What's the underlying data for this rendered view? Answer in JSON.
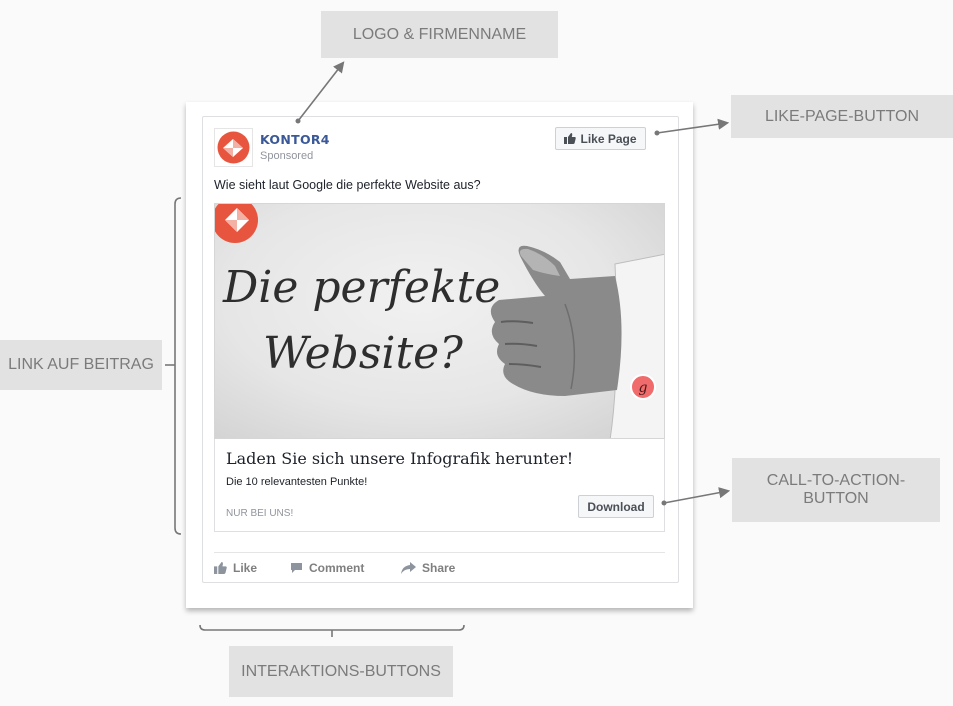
{
  "callouts": {
    "logo": "LOGO & FIRMENNAME",
    "like_page": "LIKE-PAGE-BUTTON",
    "link": "LINK AUF BEITRAG",
    "cta": "CALL-TO-ACTION-\nBUTTON",
    "interactions": "INTERAKTIONS-BUTTONS"
  },
  "ad": {
    "page_name": "KONTOR4",
    "sponsored": "Sponsored",
    "like_page_label": "Like Page",
    "post_text": "Wie sieht laut Google die perfekte Website aus?",
    "image_text_line1": "Die perfekte",
    "image_text_line2": "Website?",
    "badge_letter": "g",
    "link_title": "Laden Sie sich unsere Infografik herunter!",
    "link_description": "Die 10 relevantesten Punkte!",
    "link_domain": "NUR BEI UNS!",
    "cta_label": "Download",
    "actions": {
      "like": "Like",
      "comment": "Comment",
      "share": "Share"
    }
  },
  "colors": {
    "brand_red": "#e8553f",
    "facebook_blue": "#3b5998",
    "callout_bg": "#e2e2e2",
    "callout_text": "#7b7b7b"
  },
  "icons": [
    "kontor4-logo-icon",
    "thumbs-up-icon",
    "comment-icon",
    "share-icon",
    "google-badge-icon"
  ]
}
